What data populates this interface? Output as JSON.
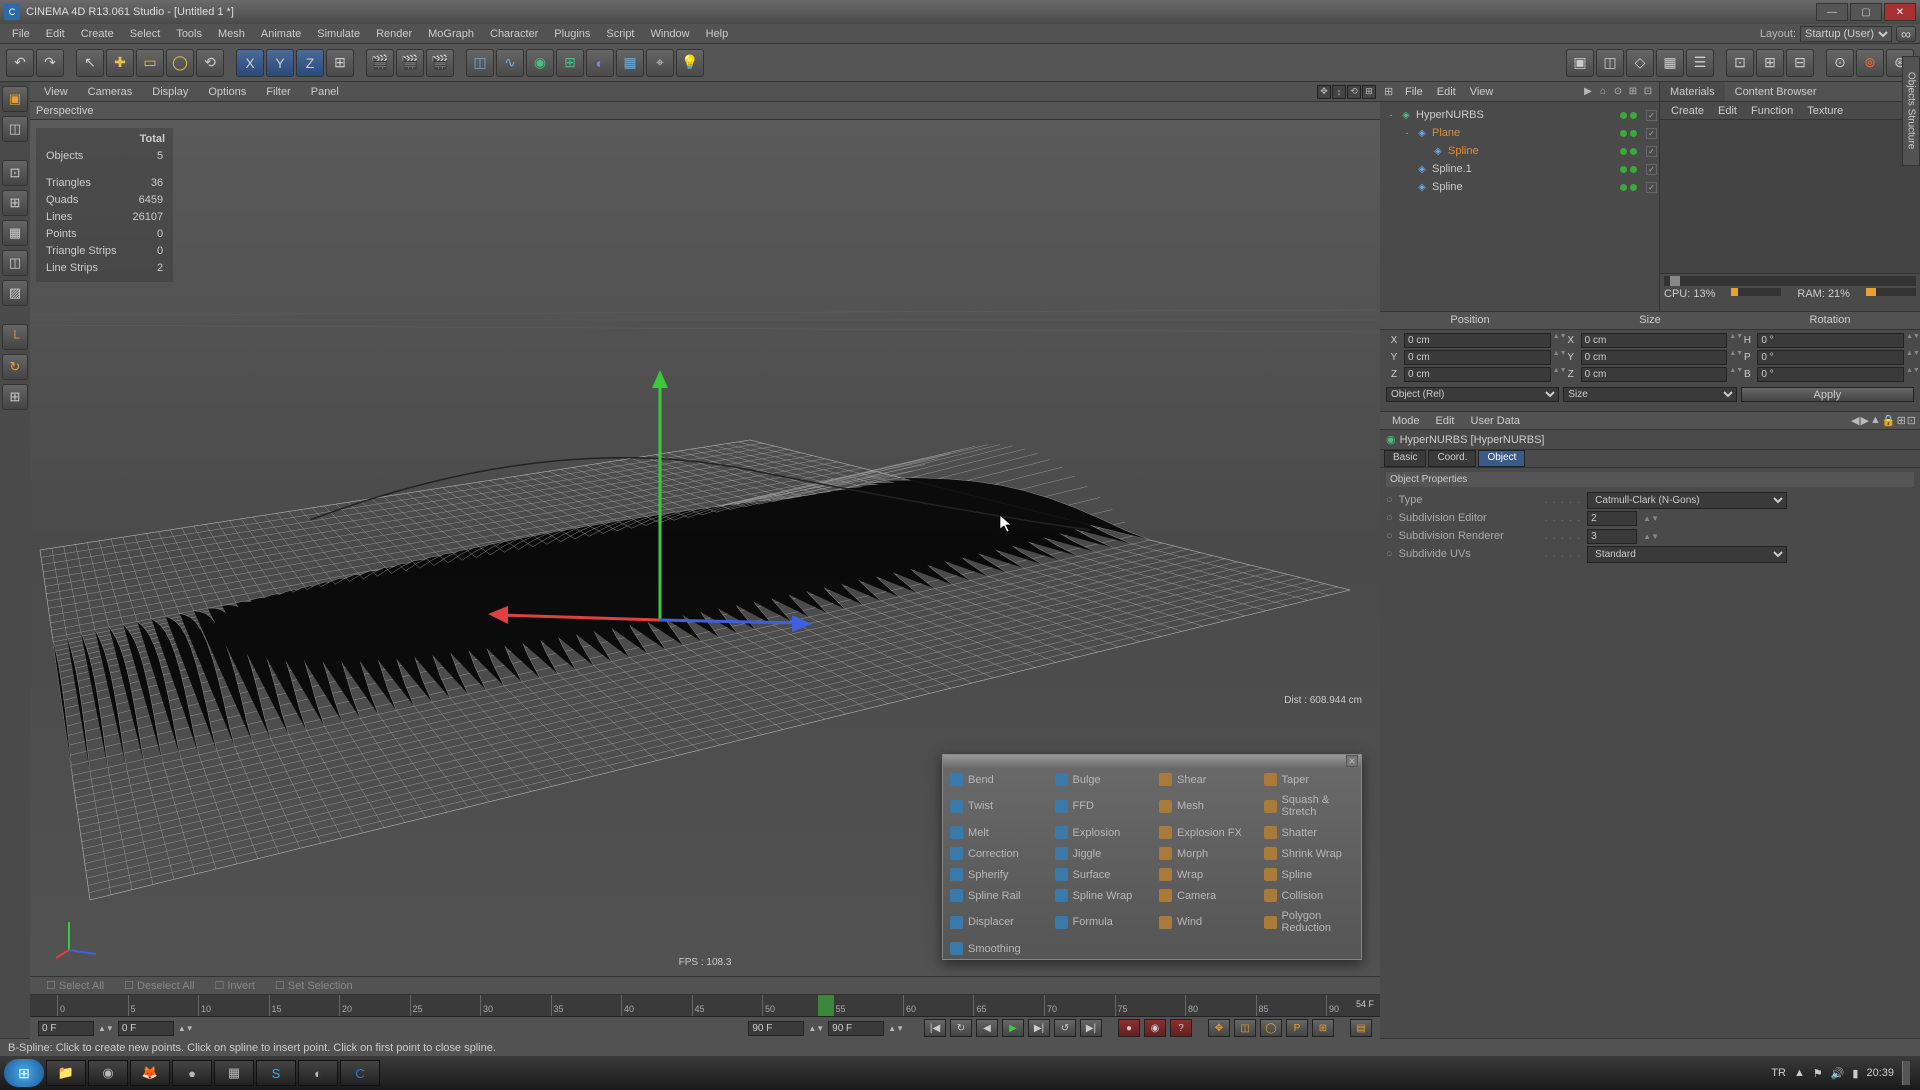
{
  "title": "CINEMA 4D R13.061 Studio - [Untitled 1 *]",
  "menubar": [
    "File",
    "Edit",
    "Create",
    "Select",
    "Tools",
    "Mesh",
    "Animate",
    "Simulate",
    "Render",
    "MoGraph",
    "Character",
    "Plugins",
    "Script",
    "Window",
    "Help"
  ],
  "layout_label": "Layout:",
  "layout_value": "Startup (User)",
  "viewport": {
    "menu": [
      "View",
      "Cameras",
      "Display",
      "Options",
      "Filter",
      "Panel"
    ],
    "label": "Perspective",
    "fps": "FPS : 108.3",
    "dist": "Dist : 608.944 cm"
  },
  "stats": {
    "header": "Total",
    "rows": [
      {
        "k": "Objects",
        "v": "5"
      },
      {
        "k": "",
        "v": ""
      },
      {
        "k": "Triangles",
        "v": "36"
      },
      {
        "k": "Quads",
        "v": "6459"
      },
      {
        "k": "Lines",
        "v": "26107"
      },
      {
        "k": "Points",
        "v": "0"
      },
      {
        "k": "Triangle Strips",
        "v": "0"
      },
      {
        "k": "Line Strips",
        "v": "2"
      }
    ]
  },
  "deformers": [
    {
      "n": "Bend"
    },
    {
      "n": "Bulge"
    },
    {
      "n": "Shear"
    },
    {
      "n": "Taper"
    },
    {
      "n": "Twist"
    },
    {
      "n": "FFD"
    },
    {
      "n": "Mesh"
    },
    {
      "n": "Squash & Stretch"
    },
    {
      "n": "Melt"
    },
    {
      "n": "Explosion"
    },
    {
      "n": "Explosion FX"
    },
    {
      "n": "Shatter"
    },
    {
      "n": "Correction"
    },
    {
      "n": "Jiggle"
    },
    {
      "n": "Morph"
    },
    {
      "n": "Shrink Wrap"
    },
    {
      "n": "Spherify"
    },
    {
      "n": "Surface"
    },
    {
      "n": "Wrap"
    },
    {
      "n": "Spline"
    },
    {
      "n": "Spline Rail"
    },
    {
      "n": "Spline Wrap"
    },
    {
      "n": "Camera"
    },
    {
      "n": "Collision"
    },
    {
      "n": "Displacer"
    },
    {
      "n": "Formula"
    },
    {
      "n": "Wind"
    },
    {
      "n": "Polygon Reduction"
    },
    {
      "n": "Smoothing"
    }
  ],
  "objmgr": {
    "menu": [
      "File",
      "Edit",
      "View"
    ],
    "items": [
      {
        "name": "HyperNURBS",
        "indent": 0,
        "exp": "-",
        "hl": false
      },
      {
        "name": "Plane",
        "indent": 1,
        "exp": "-",
        "hl": true
      },
      {
        "name": "Spline",
        "indent": 2,
        "exp": "",
        "hl": true
      },
      {
        "name": "Spline.1",
        "indent": 1,
        "exp": "",
        "hl": false
      },
      {
        "name": "Spline",
        "indent": 1,
        "exp": "",
        "hl": false
      }
    ]
  },
  "materials": {
    "tabs": [
      "Materials",
      "Content Browser"
    ],
    "menu": [
      "Create",
      "Edit",
      "Function",
      "Texture"
    ],
    "cpu_lbl": "CPU:",
    "cpu": "13%",
    "ram_lbl": "RAM:",
    "ram": "21%"
  },
  "coords": {
    "headers": [
      "Position",
      "Size",
      "Rotation"
    ],
    "rows": [
      {
        "a": "X",
        "av": "0 cm",
        "b": "X",
        "bv": "0 cm",
        "c": "H",
        "cv": "0 °"
      },
      {
        "a": "Y",
        "av": "0 cm",
        "b": "Y",
        "bv": "0 cm",
        "c": "P",
        "cv": "0 °"
      },
      {
        "a": "Z",
        "av": "0 cm",
        "b": "Z",
        "bv": "0 cm",
        "c": "B",
        "cv": "0 °"
      }
    ],
    "mode": "Object (Rel)",
    "size": "Size",
    "apply": "Apply"
  },
  "attr": {
    "menu": [
      "Mode",
      "Edit",
      "User Data"
    ],
    "title": "HyperNURBS [HyperNURBS]",
    "tabs": [
      "Basic",
      "Coord.",
      "Object"
    ],
    "section": "Object Properties",
    "props": [
      {
        "l": "Type",
        "v": "Catmull-Clark (N-Gons)",
        "t": "select"
      },
      {
        "l": "Subdivision Editor",
        "v": "2",
        "t": "num"
      },
      {
        "l": "Subdivision Renderer",
        "v": "3",
        "t": "num"
      },
      {
        "l": "Subdivide UVs",
        "v": "Standard",
        "t": "select"
      }
    ]
  },
  "tagbar": [
    "Select All",
    "Deselect All",
    "Invert",
    "Set Selection"
  ],
  "timeline": {
    "ticks": [
      0,
      5,
      10,
      15,
      20,
      25,
      30,
      35,
      40,
      45,
      50,
      55,
      60,
      65,
      70,
      75,
      80,
      85,
      90
    ],
    "playhead": 54,
    "playlabel": "54 F",
    "start": "0 F",
    "in": "0 F",
    "out": "90 F",
    "end": "90 F"
  },
  "status": "B-Spline: Click to create new points. Click on spline to insert point. Click on first point to close spline.",
  "taskbar": {
    "lang": "TR",
    "time": "20:39"
  },
  "vtabs": "Objects  Structure"
}
